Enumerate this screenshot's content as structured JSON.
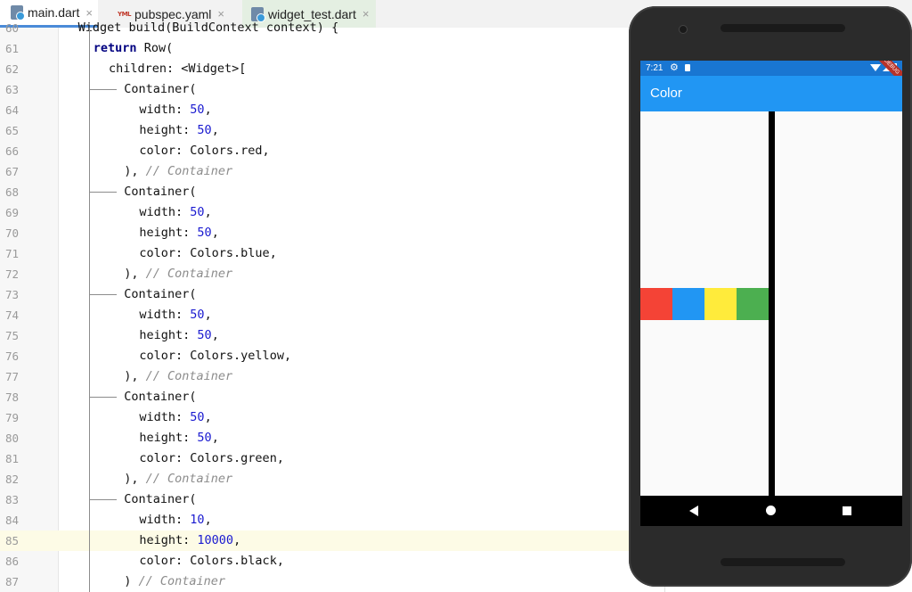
{
  "tabs": [
    {
      "name": "main.dart",
      "icon": "dart-file-icon",
      "active": true
    },
    {
      "name": "pubspec.yaml",
      "icon": "yaml-file-icon",
      "active": false
    },
    {
      "name": "widget_test.dart",
      "icon": "dart-file-icon",
      "active": false
    }
  ],
  "tab_close_glyph": "×",
  "editor": {
    "highlighted_line": "85",
    "lines": [
      {
        "num": "60",
        "indent": 6,
        "parts": [
          [
            "t",
            "Widget build(BuildContext context) {"
          ]
        ]
      },
      {
        "num": "61",
        "indent": 8,
        "parts": [
          [
            "kw",
            "return"
          ],
          [
            "t",
            " Row("
          ]
        ]
      },
      {
        "num": "62",
        "indent": 10,
        "parts": [
          [
            "t",
            "children: <Widget>["
          ]
        ]
      },
      {
        "num": "63",
        "indent": 12,
        "parts": [
          [
            "t",
            "Container("
          ]
        ]
      },
      {
        "num": "64",
        "indent": 14,
        "parts": [
          [
            "t",
            "width: "
          ],
          [
            "num",
            "50"
          ],
          [
            "t",
            ","
          ]
        ]
      },
      {
        "num": "65",
        "indent": 14,
        "parts": [
          [
            "t",
            "height: "
          ],
          [
            "num",
            "50"
          ],
          [
            "t",
            ","
          ]
        ]
      },
      {
        "num": "66",
        "indent": 14,
        "parts": [
          [
            "t",
            "color: Colors.red,"
          ]
        ]
      },
      {
        "num": "67",
        "indent": 12,
        "parts": [
          [
            "t",
            "), "
          ],
          [
            "cmt",
            "// Container"
          ]
        ]
      },
      {
        "num": "68",
        "indent": 12,
        "parts": [
          [
            "t",
            "Container("
          ]
        ]
      },
      {
        "num": "69",
        "indent": 14,
        "parts": [
          [
            "t",
            "width: "
          ],
          [
            "num",
            "50"
          ],
          [
            "t",
            ","
          ]
        ]
      },
      {
        "num": "70",
        "indent": 14,
        "parts": [
          [
            "t",
            "height: "
          ],
          [
            "num",
            "50"
          ],
          [
            "t",
            ","
          ]
        ]
      },
      {
        "num": "71",
        "indent": 14,
        "parts": [
          [
            "t",
            "color: Colors.blue,"
          ]
        ]
      },
      {
        "num": "72",
        "indent": 12,
        "parts": [
          [
            "t",
            "), "
          ],
          [
            "cmt",
            "// Container"
          ]
        ]
      },
      {
        "num": "73",
        "indent": 12,
        "parts": [
          [
            "t",
            "Container("
          ]
        ]
      },
      {
        "num": "74",
        "indent": 14,
        "parts": [
          [
            "t",
            "width: "
          ],
          [
            "num",
            "50"
          ],
          [
            "t",
            ","
          ]
        ]
      },
      {
        "num": "75",
        "indent": 14,
        "parts": [
          [
            "t",
            "height: "
          ],
          [
            "num",
            "50"
          ],
          [
            "t",
            ","
          ]
        ]
      },
      {
        "num": "76",
        "indent": 14,
        "parts": [
          [
            "t",
            "color: Colors.yellow,"
          ]
        ]
      },
      {
        "num": "77",
        "indent": 12,
        "parts": [
          [
            "t",
            "), "
          ],
          [
            "cmt",
            "// Container"
          ]
        ]
      },
      {
        "num": "78",
        "indent": 12,
        "parts": [
          [
            "t",
            "Container("
          ]
        ]
      },
      {
        "num": "79",
        "indent": 14,
        "parts": [
          [
            "t",
            "width: "
          ],
          [
            "num",
            "50"
          ],
          [
            "t",
            ","
          ]
        ]
      },
      {
        "num": "80",
        "indent": 14,
        "parts": [
          [
            "t",
            "height: "
          ],
          [
            "num",
            "50"
          ],
          [
            "t",
            ","
          ]
        ]
      },
      {
        "num": "81",
        "indent": 14,
        "parts": [
          [
            "t",
            "color: Colors.green,"
          ]
        ]
      },
      {
        "num": "82",
        "indent": 12,
        "parts": [
          [
            "t",
            "), "
          ],
          [
            "cmt",
            "// Container"
          ]
        ]
      },
      {
        "num": "83",
        "indent": 12,
        "parts": [
          [
            "t",
            "Container("
          ]
        ]
      },
      {
        "num": "84",
        "indent": 14,
        "parts": [
          [
            "t",
            "width: "
          ],
          [
            "num",
            "10"
          ],
          [
            "t",
            ","
          ]
        ]
      },
      {
        "num": "85",
        "indent": 14,
        "parts": [
          [
            "t",
            "height: "
          ],
          [
            "num",
            "10000"
          ],
          [
            "t",
            ","
          ]
        ]
      },
      {
        "num": "86",
        "indent": 14,
        "parts": [
          [
            "t",
            "color: Colors.black,"
          ]
        ]
      },
      {
        "num": "87",
        "indent": 12,
        "parts": [
          [
            "t",
            ") "
          ],
          [
            "cmt",
            "// Container"
          ]
        ]
      }
    ]
  },
  "phone": {
    "status_time": "7:21",
    "debug_banner": "DEBUG",
    "appbar_title": "Color",
    "boxes": [
      {
        "name": "red-box",
        "color": "#f44336"
      },
      {
        "name": "blue-box",
        "color": "#2196f3"
      },
      {
        "name": "yellow-box",
        "color": "#ffeb3b"
      },
      {
        "name": "green-box",
        "color": "#4caf50"
      }
    ],
    "divider_color": "#000000"
  },
  "colors": {
    "keyword": "#000080",
    "number": "#1a1ad0",
    "comment": "#8c8c8c",
    "appbar": "#2196f3",
    "statusbar": "#1976d2"
  }
}
